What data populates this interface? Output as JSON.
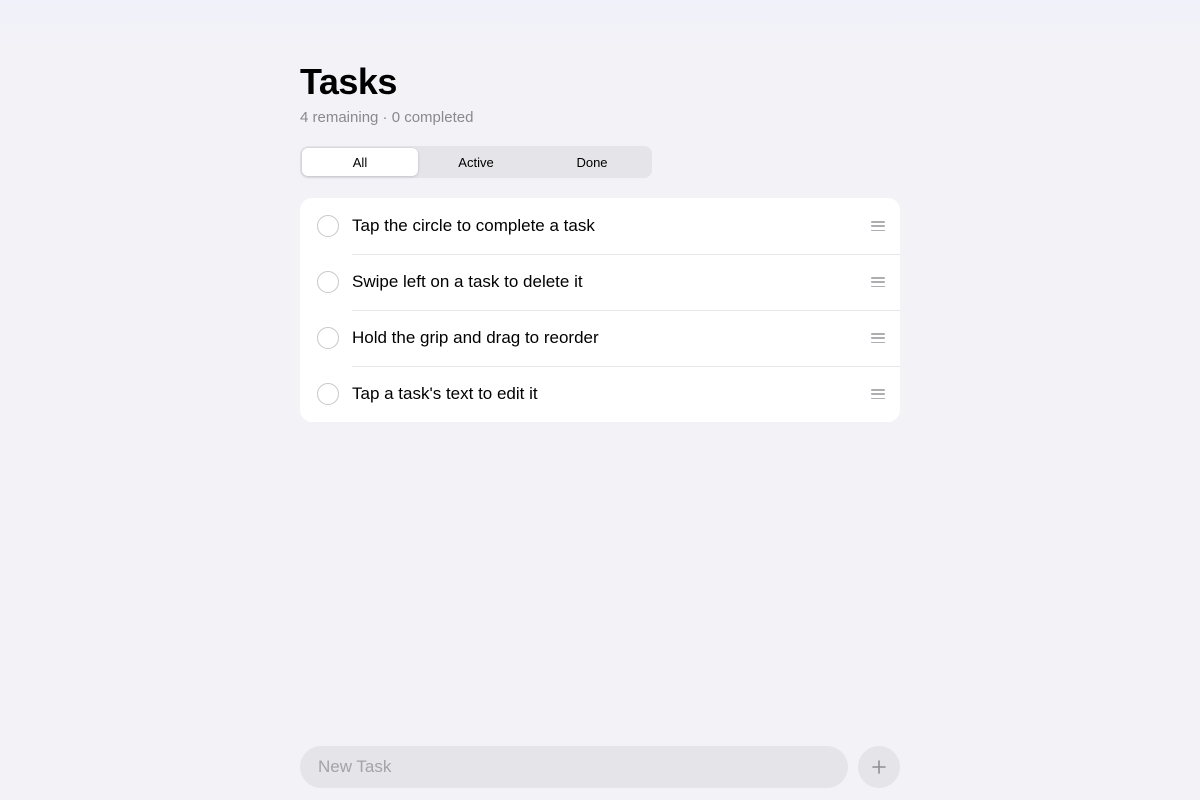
{
  "header": {
    "title": "Tasks",
    "subtitle": "4 remaining · 0 completed"
  },
  "filter": {
    "options": [
      "All",
      "Active",
      "Done"
    ],
    "selected": "All"
  },
  "tasks": [
    {
      "text": "Tap the circle to complete a task",
      "completed": false
    },
    {
      "text": "Swipe left on a task to delete it",
      "completed": false
    },
    {
      "text": "Hold the grip and drag to reorder",
      "completed": false
    },
    {
      "text": "Tap a task's text to edit it",
      "completed": false
    }
  ],
  "composer": {
    "placeholder": "New Task",
    "value": "",
    "add_icon": "plus-icon"
  },
  "colors": {
    "background": "#f2f2f7",
    "card": "#ffffff",
    "separator": "#e5e5ea",
    "secondary_text": "#8a8a8e",
    "circle_border": "#c7c7cc",
    "control_fill": "#e4e4e9"
  }
}
